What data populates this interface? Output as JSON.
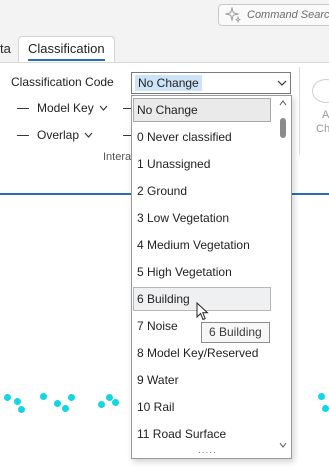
{
  "search": {
    "placeholder": "Command Search"
  },
  "tabs": {
    "partial": "ta",
    "active": "Classification"
  },
  "ribbon": {
    "classification_code_label": "Classification Code",
    "classification_code_value": "No Change",
    "model_key_label": "Model Key",
    "overlap_label": "Overlap",
    "group_label": "Intera",
    "side_label_a": "A",
    "side_label_ch": "Ch"
  },
  "dropdown": {
    "items": [
      "No Change",
      "0 Never classified",
      "1 Unassigned",
      "2 Ground",
      "3 Low Vegetation",
      "4 Medium Vegetation",
      "5 High Vegetation",
      "6 Building",
      "7 Noise",
      "8 Model Key/Reserved",
      "9 Water",
      "10 Rail",
      "11 Road Surface"
    ],
    "selected_index": 0,
    "hovered_index": 7,
    "grip": "....."
  },
  "tooltip": {
    "text": "6 Building"
  },
  "colors": {
    "accent": "#2a6db5",
    "points": "#12d6e4"
  },
  "icons": {
    "search": "sparkle-icon",
    "cursor": "mouse-pointer-icon"
  }
}
